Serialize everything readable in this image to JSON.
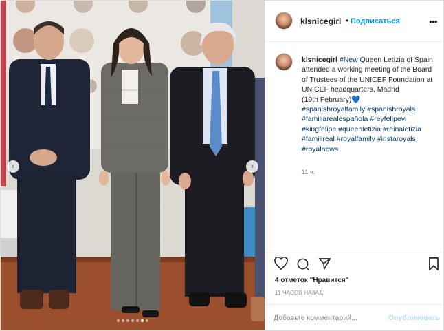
{
  "post": {
    "username": "klsnicegirl",
    "separator": "•",
    "follow_label": "Подписаться",
    "more_label": "•••"
  },
  "caption": {
    "username": "klsnicegirl",
    "segments": [
      {
        "text": "#New",
        "type": "tag"
      },
      {
        "text": " Queen Letizia of Spain attended a working meeting of the Board of Trustees of the UNICEF Foundation at UNICEF headquarters, Madrid\n(19th February)",
        "type": "text"
      },
      {
        "text": "💙",
        "type": "heart"
      },
      {
        "text": "\n",
        "type": "text"
      },
      {
        "text": "#spanishroyalfamily",
        "type": "tag"
      },
      {
        "text": " ",
        "type": "text"
      },
      {
        "text": "#spanishroyals",
        "type": "tag"
      },
      {
        "text": " ",
        "type": "text"
      },
      {
        "text": "#familiarealespañola",
        "type": "tag"
      },
      {
        "text": " ",
        "type": "text"
      },
      {
        "text": "#reyfelipevi",
        "type": "tag"
      },
      {
        "text": " ",
        "type": "text"
      },
      {
        "text": "#kingfelipe",
        "type": "tag"
      },
      {
        "text": " ",
        "type": "text"
      },
      {
        "text": "#queenletizia",
        "type": "tag"
      },
      {
        "text": " ",
        "type": "text"
      },
      {
        "text": "#reinaletizia",
        "type": "tag"
      },
      {
        "text": " ",
        "type": "text"
      },
      {
        "text": "#familireal",
        "type": "tag"
      },
      {
        "text": " ",
        "type": "text"
      },
      {
        "text": "#royalfamily",
        "type": "tag"
      },
      {
        "text": " ",
        "type": "text"
      },
      {
        "text": "#instaroyals",
        "type": "tag"
      },
      {
        "text": " ",
        "type": "text"
      },
      {
        "text": "#royalnews",
        "type": "tag"
      }
    ],
    "time_ago": "11 ч."
  },
  "actions": {
    "icons": [
      "heart-icon",
      "comment-icon",
      "share-icon",
      "bookmark-icon"
    ]
  },
  "likes_label": "4 отметок \"Нравится\"",
  "timestamp_label": "11 ЧАСОВ НАЗАД",
  "comment": {
    "placeholder": "Добавьте комментарий...",
    "publish_label": "Опубликовать"
  },
  "carousel": {
    "prev_arrow": "‹",
    "next_arrow": "›",
    "slide_count": 7,
    "active_slide": 6
  },
  "colors": {
    "link_blue": "#0095f6",
    "tag_blue": "#00376b",
    "publish_disabled": "#b2dffc",
    "muted_text": "#8e8e8e"
  }
}
